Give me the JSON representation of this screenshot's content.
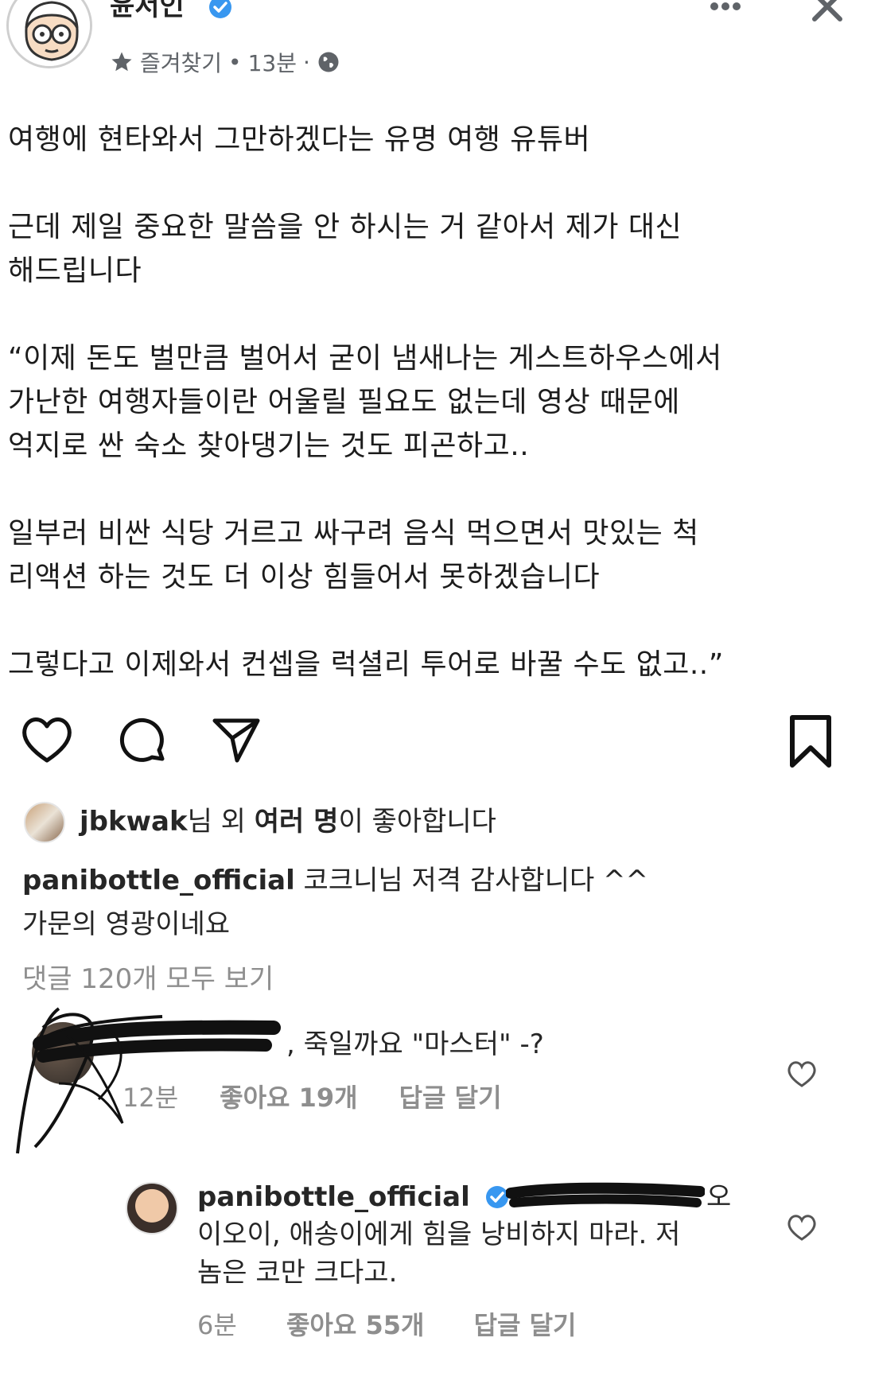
{
  "header": {
    "author_name": "윤서인",
    "favorites_label": "즐겨찾기",
    "separator": "•",
    "time": "13분",
    "dot": "·",
    "privacy_icon": "globe-icon",
    "more_icon": "more-horizontal-icon",
    "close_icon": "close-icon"
  },
  "post": {
    "lines": [
      "여행에 현타와서 그만하겠다는 유명 여행 유튜버",
      "",
      "근데 제일 중요한 말씀을 안 하시는 거 같아서 제가 대신",
      "해드립니다",
      "",
      "“이제 돈도 벌만큼 벌어서 굳이 냄새나는 게스트하우스에서",
      "가난한 여행자들이란 어울릴 필요도 없는데 영상 때문에",
      "억지로 싼 숙소 찾아댕기는 것도 피곤하고..",
      "",
      "일부러 비싼 식당 거르고 싸구려 음식 먹으면서 맛있는 척",
      "리액션 하는 것도 더 이상 힘들어서 못하겠습니다",
      "",
      "그렇다고 이제와서 컨셉을 럭셜리 투어로 바꿀 수도 없고..”"
    ]
  },
  "actions": {
    "like_icon": "heart-icon",
    "comment_icon": "comment-icon",
    "share_icon": "send-icon",
    "bookmark_icon": "bookmark-icon"
  },
  "likes": {
    "user": "jbkwak",
    "suffix1": "님 외 ",
    "others": "여러 명",
    "suffix2": "이 좋아합니다"
  },
  "caption": {
    "user": "panibottle_official",
    "text_line1": " 코크니님 저격 감사합니다 ^^",
    "text_line2": "가문의 영광이네요"
  },
  "view_all_comments": "댓글 120개 모두 보기",
  "comment1": {
    "visible_tail": ", 죽일까요 \"마스터\" -?",
    "time": "12분",
    "likes": "좋아요 19개",
    "reply_label": "답글 달기"
  },
  "reply": {
    "user": "panibottle_official",
    "tail": "오",
    "line1": "이오이, 애송이에게 힘을 낭비하지 마라. 저",
    "line2": "놈은 코만 크다고.",
    "time": "6분",
    "likes": "좋아요 55개",
    "reply_label": "답글 달기"
  },
  "colors": {
    "text": "#262626",
    "secondary": "#8e8e8e",
    "verified_blue": "#3897f0",
    "meta_gray": "#5f6368"
  }
}
